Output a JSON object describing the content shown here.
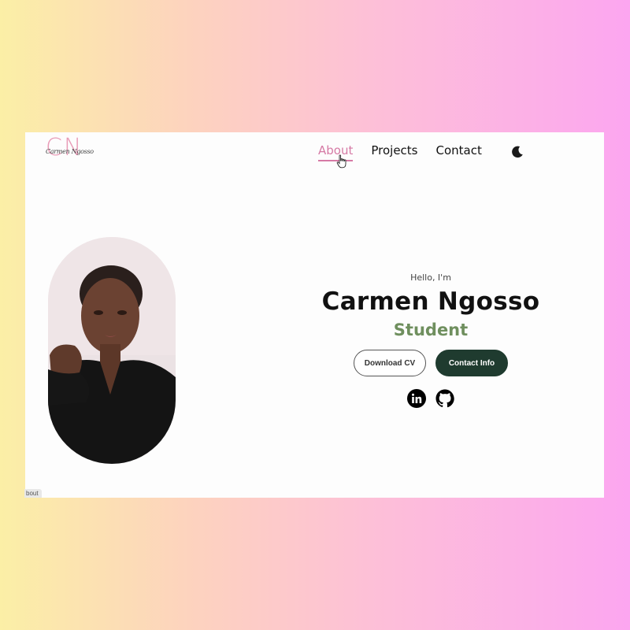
{
  "logo": {
    "initials": "CN",
    "script": "Carmen Ngosso"
  },
  "nav": {
    "items": [
      {
        "label": "About",
        "active": true
      },
      {
        "label": "Projects",
        "active": false
      },
      {
        "label": "Contact",
        "active": false
      }
    ],
    "theme_toggle_icon": "moon-icon"
  },
  "hero": {
    "greeting": "Hello, I'm",
    "name": "Carmen Ngosso",
    "role": "Student",
    "buttons": {
      "download_cv": "Download CV",
      "contact_info": "Contact Info"
    },
    "socials": [
      "linkedin-icon",
      "github-icon"
    ]
  },
  "status_bar": {
    "text": "bout"
  },
  "colors": {
    "accent_pink": "#d67aa5",
    "role_green": "#6f8f5e",
    "button_dark": "#1f3b2f"
  }
}
